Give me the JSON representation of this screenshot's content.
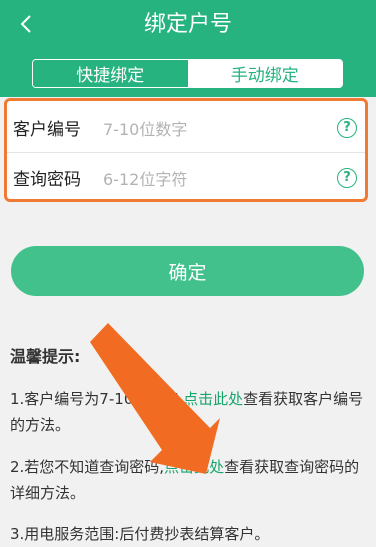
{
  "header": {
    "back_icon": "chevron-left-icon",
    "title": "绑定户号",
    "tabs": [
      {
        "label": "快捷绑定",
        "active": false
      },
      {
        "label": "手动绑定",
        "active": true
      }
    ]
  },
  "form": {
    "customer_no": {
      "label": "客户编号",
      "placeholder": "7-10位数字",
      "help_icon": "question-circle-icon"
    },
    "query_pwd": {
      "label": "查询密码",
      "placeholder": "6-12位字符",
      "help_icon": "question-circle-icon"
    }
  },
  "confirm_label": "确定",
  "tips": {
    "title": "温馨提示:",
    "tip1": {
      "prefix": "1.客户编号为7-",
      "hidden": "10位",
      "middle": "数字,",
      "link": "点击此处",
      "suffix": "查看获取客户编号的方法。"
    },
    "tip2": {
      "prefix": "2.若您不知道查询密码,",
      "link": "点击此处",
      "suffix": "查看获取查询密码的详细方法。"
    },
    "tip3": {
      "text": "3.用电服务范围:后付费抄表结算客户。"
    }
  },
  "colors": {
    "primary": "#26b37f",
    "button": "#43c18d",
    "highlight": "#f07a33"
  }
}
